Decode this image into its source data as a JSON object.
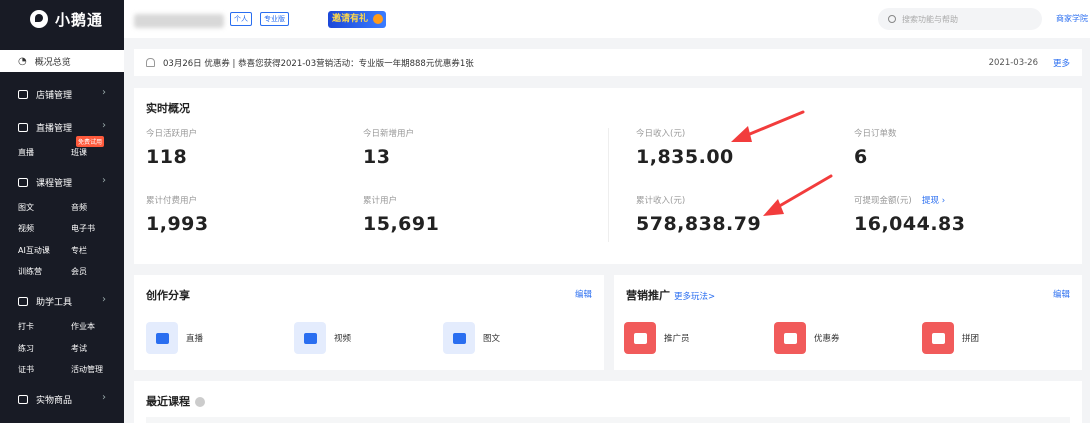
{
  "app": {
    "name": "小鹅通"
  },
  "header": {
    "tags": [
      "个人",
      "专业版"
    ],
    "invite_label": "邀请有礼",
    "search_placeholder": "搜索功能与帮助",
    "merchant_link": "商家学院"
  },
  "sidebar": {
    "active_item": "概况总览",
    "groups": [
      {
        "label": "店铺管理",
        "icon": "shop-icon"
      },
      {
        "label": "直播管理",
        "icon": "live-icon",
        "items": [
          "直播",
          "班课"
        ],
        "badge": "免费试用"
      },
      {
        "label": "课程管理",
        "icon": "course-icon",
        "items": [
          "图文",
          "音频",
          "视频",
          "电子书",
          "AI互动课",
          "专栏",
          "训练营",
          "会员"
        ]
      },
      {
        "label": "助学工具",
        "icon": "tools-icon",
        "items": [
          "打卡",
          "作业本",
          "练习",
          "考试",
          "证书",
          "活动管理"
        ]
      },
      {
        "label": "实物商品",
        "icon": "goods-icon"
      }
    ]
  },
  "notice": {
    "text": "03月26日 优惠券 | 恭喜您获得2021-03营销活动：专业版一年期888元优惠券1张",
    "date": "2021-03-26",
    "more": "更多"
  },
  "stats": {
    "title": "实时概况",
    "items": [
      {
        "label": "今日活跃用户",
        "value": "118"
      },
      {
        "label": "今日新增用户",
        "value": "13"
      },
      {
        "label": "今日收入(元)",
        "value": "1,835.00"
      },
      {
        "label": "今日订单数",
        "value": "6"
      },
      {
        "label": "累计付费用户",
        "value": "1,993"
      },
      {
        "label": "累计用户",
        "value": "15,691"
      },
      {
        "label": "累计收入(元)",
        "value": "578,838.79"
      },
      {
        "label": "可提现金额(元)",
        "value": "16,044.83",
        "link": "提现 ›"
      }
    ]
  },
  "create": {
    "title": "创作分享",
    "edit": "编辑",
    "tiles": [
      {
        "label": "直播",
        "icon": "live-tv-icon"
      },
      {
        "label": "视频",
        "icon": "video-camera-icon"
      },
      {
        "label": "图文",
        "icon": "article-icon"
      }
    ]
  },
  "market": {
    "title": "营销推广",
    "more_link": "更多玩法>",
    "edit": "编辑",
    "tiles": [
      {
        "label": "推广员",
        "icon": "megaphone-icon"
      },
      {
        "label": "优惠券",
        "icon": "coupon-icon"
      },
      {
        "label": "拼团",
        "icon": "group-buy-icon"
      }
    ]
  },
  "recent": {
    "title": "最近课程"
  },
  "colors": {
    "accent": "#2a6ef0",
    "sidebar": "#181b25",
    "annotation_arrow": "#f23c3c",
    "tile_red": "#f15b5b"
  }
}
